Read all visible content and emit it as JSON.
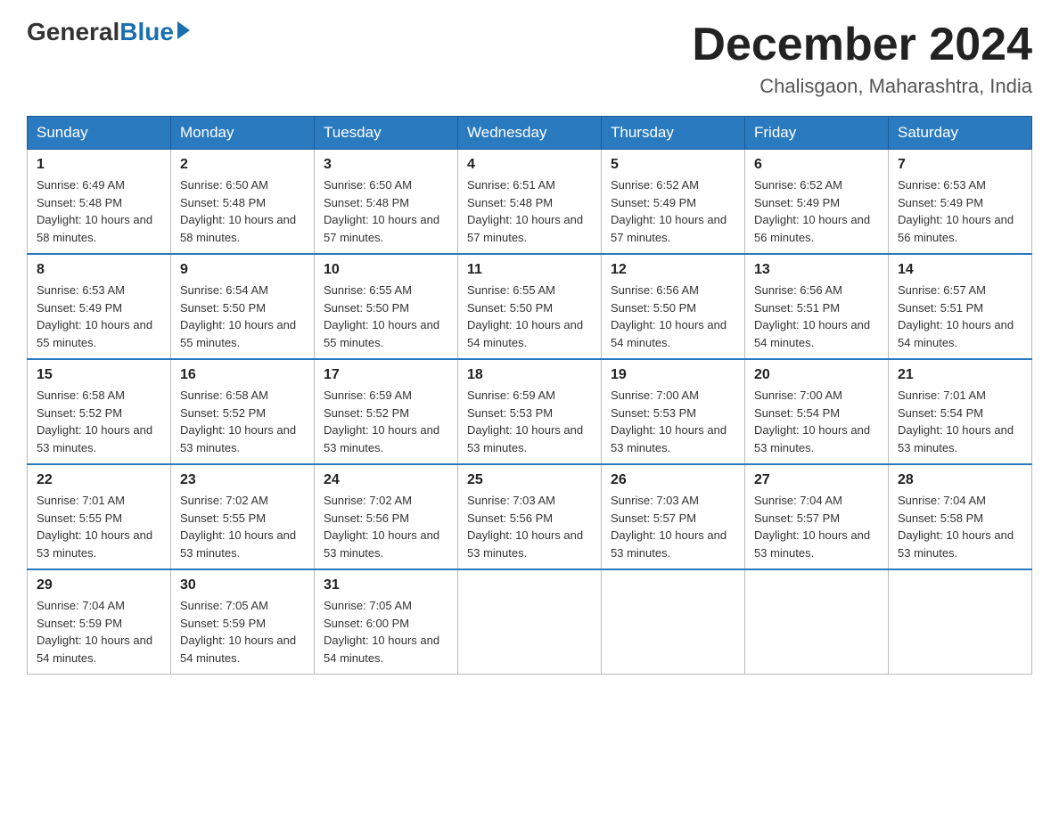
{
  "logo": {
    "general": "General",
    "blue": "Blue"
  },
  "title": "December 2024",
  "subtitle": "Chalisgaon, Maharashtra, India",
  "weekdays": [
    "Sunday",
    "Monday",
    "Tuesday",
    "Wednesday",
    "Thursday",
    "Friday",
    "Saturday"
  ],
  "weeks": [
    [
      {
        "day": "1",
        "sunrise": "6:49 AM",
        "sunset": "5:48 PM",
        "daylight": "10 hours and 58 minutes."
      },
      {
        "day": "2",
        "sunrise": "6:50 AM",
        "sunset": "5:48 PM",
        "daylight": "10 hours and 58 minutes."
      },
      {
        "day": "3",
        "sunrise": "6:50 AM",
        "sunset": "5:48 PM",
        "daylight": "10 hours and 57 minutes."
      },
      {
        "day": "4",
        "sunrise": "6:51 AM",
        "sunset": "5:48 PM",
        "daylight": "10 hours and 57 minutes."
      },
      {
        "day": "5",
        "sunrise": "6:52 AM",
        "sunset": "5:49 PM",
        "daylight": "10 hours and 57 minutes."
      },
      {
        "day": "6",
        "sunrise": "6:52 AM",
        "sunset": "5:49 PM",
        "daylight": "10 hours and 56 minutes."
      },
      {
        "day": "7",
        "sunrise": "6:53 AM",
        "sunset": "5:49 PM",
        "daylight": "10 hours and 56 minutes."
      }
    ],
    [
      {
        "day": "8",
        "sunrise": "6:53 AM",
        "sunset": "5:49 PM",
        "daylight": "10 hours and 55 minutes."
      },
      {
        "day": "9",
        "sunrise": "6:54 AM",
        "sunset": "5:50 PM",
        "daylight": "10 hours and 55 minutes."
      },
      {
        "day": "10",
        "sunrise": "6:55 AM",
        "sunset": "5:50 PM",
        "daylight": "10 hours and 55 minutes."
      },
      {
        "day": "11",
        "sunrise": "6:55 AM",
        "sunset": "5:50 PM",
        "daylight": "10 hours and 54 minutes."
      },
      {
        "day": "12",
        "sunrise": "6:56 AM",
        "sunset": "5:50 PM",
        "daylight": "10 hours and 54 minutes."
      },
      {
        "day": "13",
        "sunrise": "6:56 AM",
        "sunset": "5:51 PM",
        "daylight": "10 hours and 54 minutes."
      },
      {
        "day": "14",
        "sunrise": "6:57 AM",
        "sunset": "5:51 PM",
        "daylight": "10 hours and 54 minutes."
      }
    ],
    [
      {
        "day": "15",
        "sunrise": "6:58 AM",
        "sunset": "5:52 PM",
        "daylight": "10 hours and 53 minutes."
      },
      {
        "day": "16",
        "sunrise": "6:58 AM",
        "sunset": "5:52 PM",
        "daylight": "10 hours and 53 minutes."
      },
      {
        "day": "17",
        "sunrise": "6:59 AM",
        "sunset": "5:52 PM",
        "daylight": "10 hours and 53 minutes."
      },
      {
        "day": "18",
        "sunrise": "6:59 AM",
        "sunset": "5:53 PM",
        "daylight": "10 hours and 53 minutes."
      },
      {
        "day": "19",
        "sunrise": "7:00 AM",
        "sunset": "5:53 PM",
        "daylight": "10 hours and 53 minutes."
      },
      {
        "day": "20",
        "sunrise": "7:00 AM",
        "sunset": "5:54 PM",
        "daylight": "10 hours and 53 minutes."
      },
      {
        "day": "21",
        "sunrise": "7:01 AM",
        "sunset": "5:54 PM",
        "daylight": "10 hours and 53 minutes."
      }
    ],
    [
      {
        "day": "22",
        "sunrise": "7:01 AM",
        "sunset": "5:55 PM",
        "daylight": "10 hours and 53 minutes."
      },
      {
        "day": "23",
        "sunrise": "7:02 AM",
        "sunset": "5:55 PM",
        "daylight": "10 hours and 53 minutes."
      },
      {
        "day": "24",
        "sunrise": "7:02 AM",
        "sunset": "5:56 PM",
        "daylight": "10 hours and 53 minutes."
      },
      {
        "day": "25",
        "sunrise": "7:03 AM",
        "sunset": "5:56 PM",
        "daylight": "10 hours and 53 minutes."
      },
      {
        "day": "26",
        "sunrise": "7:03 AM",
        "sunset": "5:57 PM",
        "daylight": "10 hours and 53 minutes."
      },
      {
        "day": "27",
        "sunrise": "7:04 AM",
        "sunset": "5:57 PM",
        "daylight": "10 hours and 53 minutes."
      },
      {
        "day": "28",
        "sunrise": "7:04 AM",
        "sunset": "5:58 PM",
        "daylight": "10 hours and 53 minutes."
      }
    ],
    [
      {
        "day": "29",
        "sunrise": "7:04 AM",
        "sunset": "5:59 PM",
        "daylight": "10 hours and 54 minutes."
      },
      {
        "day": "30",
        "sunrise": "7:05 AM",
        "sunset": "5:59 PM",
        "daylight": "10 hours and 54 minutes."
      },
      {
        "day": "31",
        "sunrise": "7:05 AM",
        "sunset": "6:00 PM",
        "daylight": "10 hours and 54 minutes."
      },
      null,
      null,
      null,
      null
    ]
  ],
  "labels": {
    "sunrise": "Sunrise: ",
    "sunset": "Sunset: ",
    "daylight": "Daylight: "
  }
}
